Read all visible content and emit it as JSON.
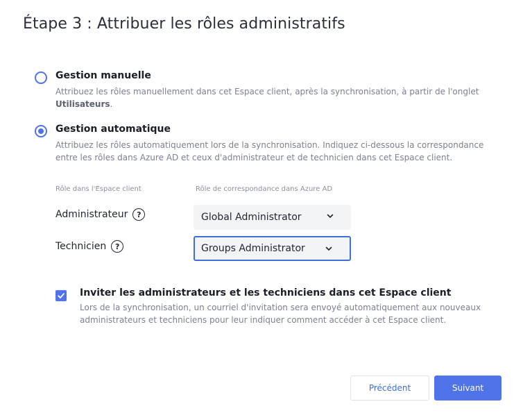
{
  "page": {
    "title": "Étape 3 : Attribuer les rôles administratifs"
  },
  "options": {
    "manual": {
      "title": "Gestion manuelle",
      "desc_before": "Attribuez les rôles manuellement dans cet Espace client, après la synchronisation, à partir de l'onglet ",
      "desc_bold": "Utilisateurs",
      "desc_after": ".",
      "selected": false
    },
    "auto": {
      "title": "Gestion automatique",
      "desc": "Attribuez les rôles automatiquement lors de la synchronisation. Indiquez ci-dessous la correspondance entre les rôles dans Azure AD et ceux d'administrateur et de technicien dans cet Espace client.",
      "selected": true
    }
  },
  "mapping": {
    "col_client_role": "Rôle dans l'Espace client",
    "col_azure_role": "Rôle de correspondance dans Azure AD",
    "rows": [
      {
        "role": "Administrateur",
        "help": "?",
        "azure_role": "Global Administrator"
      },
      {
        "role": "Technicien",
        "help": "?",
        "azure_role": "Groups Administrator"
      }
    ]
  },
  "invite": {
    "checked": true,
    "title": "Inviter les administrateurs et les techniciens dans cet Espace client",
    "desc": "Lors de la synchronisation, un courriel d'invitation sera envoyé automatiquement aux nouveaux administrateurs et techniciens pour leur indiquer comment accéder à cet Espace client."
  },
  "actions": {
    "prev_label": "Précédent",
    "next_label": "Suivant"
  },
  "colors": {
    "accent": "#4f73e8",
    "focus_border": "#3d6fd8",
    "muted_text": "#7b8190"
  },
  "icons": {
    "help": "question-circle-icon",
    "chevron": "chevron-down-icon",
    "check": "check-icon"
  }
}
